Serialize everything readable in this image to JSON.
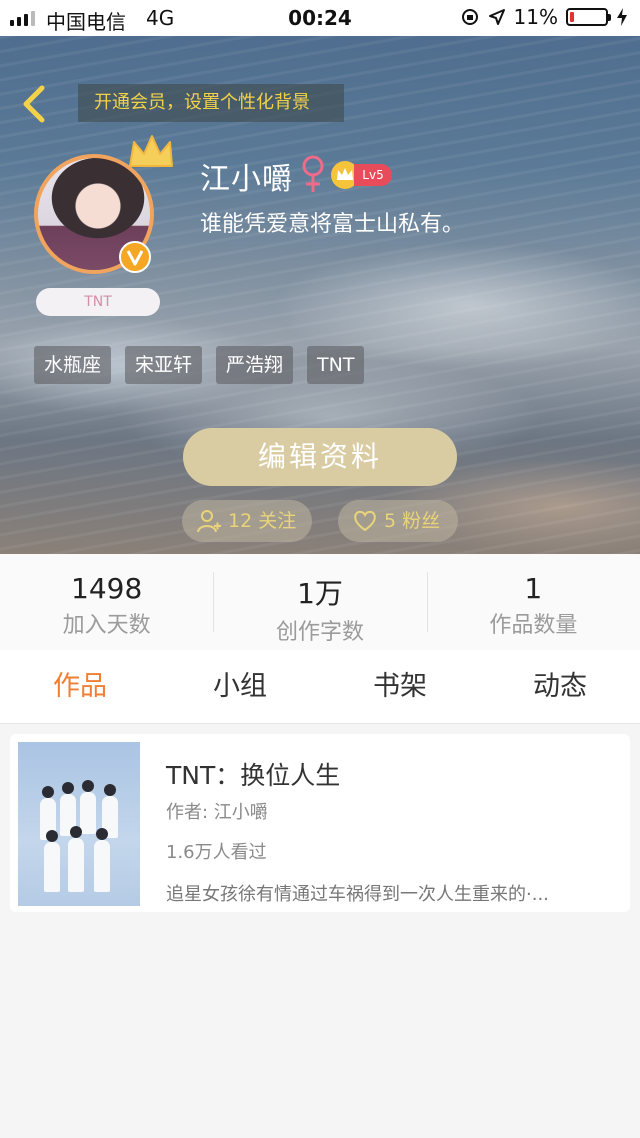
{
  "status_bar": {
    "carrier": "中国电信",
    "network": "4G",
    "time": "00:24",
    "battery": "11%",
    "battery_level": 0.11,
    "battery_color": "#e33333"
  },
  "header": {
    "back_icon": "chevron-left-icon",
    "vip_banner": "开通会员，设置个性化背景"
  },
  "profile": {
    "name": "江小嚼",
    "gender_icon": "female-icon",
    "level": "Lv5",
    "bio": "谁能凭爱意将富士山私有。",
    "pill_label": "TNT",
    "tags": [
      "水瓶座",
      "宋亚轩",
      "严浩翔",
      "TNT"
    ],
    "edit_button": "编辑资料",
    "following": "12 关注",
    "fans": "5 粉丝"
  },
  "stats": [
    {
      "value": "1498",
      "label": "加入天数"
    },
    {
      "value": "1万",
      "label": "创作字数"
    },
    {
      "value": "1",
      "label": "作品数量"
    }
  ],
  "tabs": [
    {
      "label": "作品",
      "active": true
    },
    {
      "label": "小组",
      "active": false
    },
    {
      "label": "书架",
      "active": false
    },
    {
      "label": "动态",
      "active": false
    }
  ],
  "works": [
    {
      "title": "TNT：换位人生",
      "author": "作者: 江小嚼",
      "views": "1.6万人看过",
      "description": "追星女孩徐有情通过车祸得到一次人生重来的·..."
    }
  ],
  "colors": {
    "accent": "#f07f34",
    "gold": "#d9cca3",
    "vip_text": "#f3d24a",
    "level_badge": "#e84c5a"
  }
}
